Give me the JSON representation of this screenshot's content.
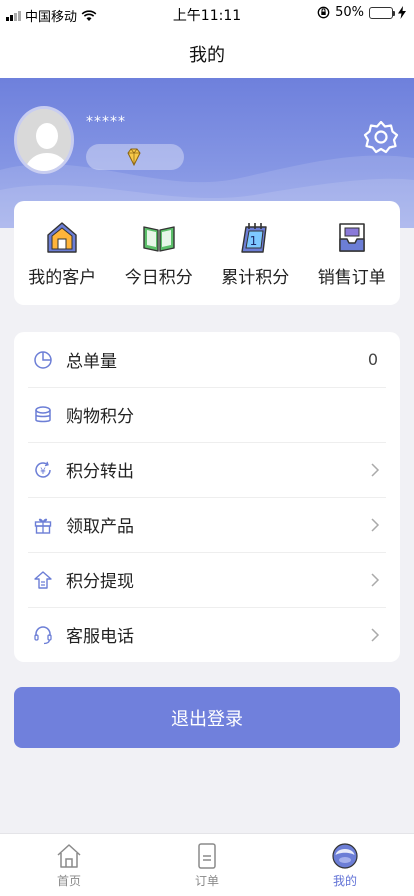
{
  "status_bar": {
    "carrier": "中国移动",
    "time": "上午11:11",
    "battery_percent": "50%",
    "battery_level": 0.5
  },
  "nav": {
    "title": "我的"
  },
  "profile": {
    "username": "*****",
    "avatar_icon": "default-avatar-icon",
    "level_icon": "diamond-icon",
    "settings_icon": "gear-icon"
  },
  "quick_actions": [
    {
      "label": "我的客户",
      "icon": "house-icon"
    },
    {
      "label": "今日积分",
      "icon": "book-icon"
    },
    {
      "label": "累计积分",
      "icon": "calendar-icon"
    },
    {
      "label": "销售订单",
      "icon": "inbox-icon"
    }
  ],
  "menu": [
    {
      "label": "总单量",
      "value": "0",
      "icon": "pie-chart-icon",
      "chevron": false
    },
    {
      "label": "购物积分",
      "value": "",
      "icon": "coins-stack-icon",
      "chevron": false
    },
    {
      "label": "积分转出",
      "value": "",
      "icon": "yuan-refresh-icon",
      "chevron": true
    },
    {
      "label": "领取产品",
      "value": "",
      "icon": "gift-icon",
      "chevron": true
    },
    {
      "label": "积分提现",
      "value": "",
      "icon": "withdraw-icon",
      "chevron": true
    },
    {
      "label": "客服电话",
      "value": "",
      "icon": "headset-icon",
      "chevron": true
    }
  ],
  "logout_label": "退出登录",
  "tabs": [
    {
      "label": "首页",
      "icon": "home-icon",
      "active": false
    },
    {
      "label": "订单",
      "icon": "document-icon",
      "active": false
    },
    {
      "label": "我的",
      "icon": "profile-face-icon",
      "active": true
    }
  ],
  "colors": {
    "accent": "#7080dc",
    "header_gradient_top": "#6e80dc",
    "header_gradient_bottom": "#9aa8ea",
    "active_tab": "#6172d6",
    "page_background": "#f1f1f5"
  }
}
